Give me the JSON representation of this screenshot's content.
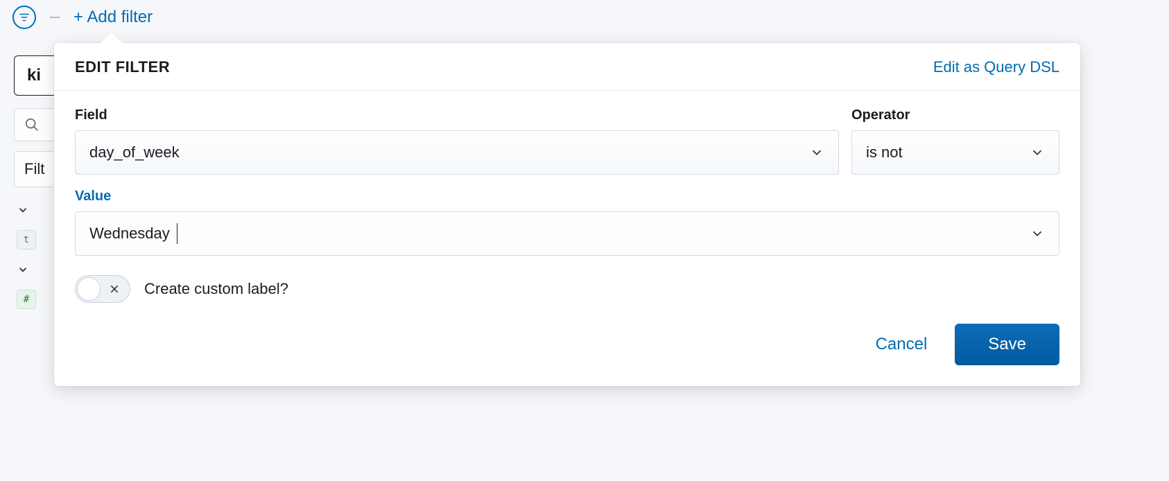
{
  "filterBar": {
    "addFilterLabel": "+ Add filter"
  },
  "sidebar": {
    "indexStub": "ki",
    "filterStub": "Filt"
  },
  "popover": {
    "title": "EDIT FILTER",
    "queryDslLink": "Edit as Query DSL",
    "fieldLabel": "Field",
    "operatorLabel": "Operator",
    "valueLabel": "Value",
    "fieldValue": "day_of_week",
    "operatorValue": "is not",
    "valueValue": "Wednesday",
    "customLabelToggleLabel": "Create custom label?",
    "customLabelToggleOn": false,
    "cancelLabel": "Cancel",
    "saveLabel": "Save"
  }
}
